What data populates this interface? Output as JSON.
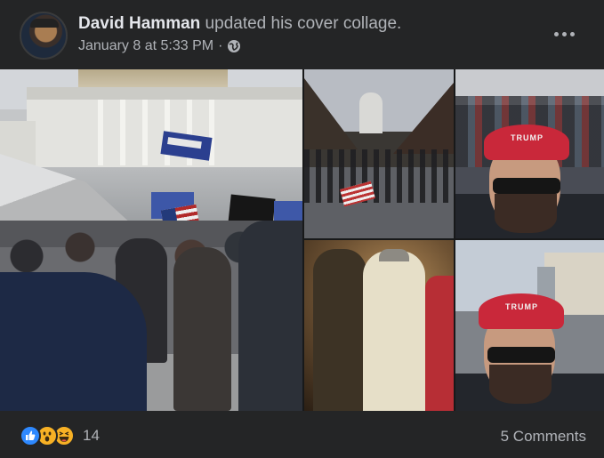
{
  "post": {
    "author": "David Hamman",
    "action": " updated his cover collage.",
    "timestamp": "January 8 at 5:33 PM",
    "separator": "·",
    "privacy_icon": "globe-icon",
    "more_icon": "more-options-icon"
  },
  "collage": {
    "photos": [
      {
        "name": "capitol-crowd-photo",
        "caption": ""
      },
      {
        "name": "street-march-photo",
        "caption": ""
      },
      {
        "name": "selfie-red-cap-photo",
        "caption": ""
      },
      {
        "name": "hallway-photo",
        "caption": ""
      },
      {
        "name": "selfie-red-cap-photo-2",
        "caption": ""
      }
    ],
    "sign_texts": {
      "flag_trump": "TRUMP",
      "cap_text": "TRUMP"
    }
  },
  "footer": {
    "reaction_icons": [
      "like-icon",
      "wow-icon",
      "haha-icon"
    ],
    "reaction_count": "14",
    "comments_label": "5 Comments"
  },
  "colors": {
    "background": "#242526",
    "primary_text": "#e4e6eb",
    "secondary_text": "#b0b3b8",
    "like_blue": "#2e89ff",
    "reaction_yellow": "#f7b125",
    "cap_red": "#c9283a"
  }
}
